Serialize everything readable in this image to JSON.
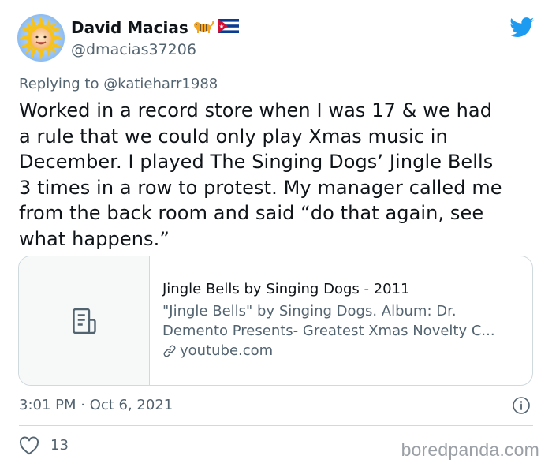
{
  "author": {
    "display_name": "David Macias",
    "handle": "@dmacias37206",
    "avatar_icon": "sun-baby-avatar",
    "badges": [
      "tiger-emoji-icon",
      "cuba-flag-icon"
    ]
  },
  "brand": {
    "icon": "twitter-bird-icon",
    "color": "#1d9bf0"
  },
  "reply": {
    "prefix": "Replying to",
    "mention": "@katieharr1988"
  },
  "tweet": {
    "lines": [
      "Worked in a record store when I was 17 & we had",
      "a rule that we could only play Xmas music in",
      "December. I played The Singing Dogs’ Jingle Bells",
      "3 times in a row to protest. My manager called me",
      "from the back room and said “do that again, see",
      "what happens.”"
    ]
  },
  "card": {
    "thumb_icon": "document-icon",
    "title": "Jingle Bells by Singing Dogs - 2011",
    "description_lines": [
      "\"Jingle Bells\" by Singing Dogs. Album: Dr.",
      "Demento Presents- Greatest Xmas Novelty C..."
    ],
    "domain": "youtube.com",
    "domain_icon": "link-icon"
  },
  "meta": {
    "timestamp": "3:01 PM · Oct 6, 2021",
    "info_icon": "info-icon"
  },
  "engagement": {
    "likes": "13",
    "like_icon": "heart-icon"
  },
  "watermark": "boredpanda.com"
}
